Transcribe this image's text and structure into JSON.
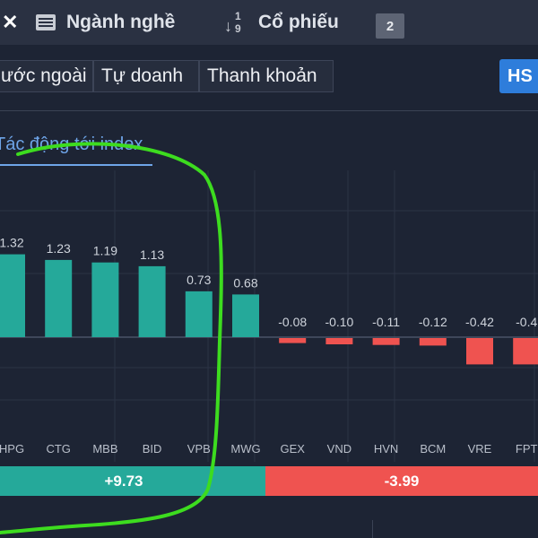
{
  "header": {
    "close_glyph": "✕",
    "industry_label": "Ngành nghề",
    "sort_digit_top": "1",
    "sort_digit_bottom": "9",
    "stocks_label": "Cổ phiếu",
    "badge_count": "2"
  },
  "filters": {
    "foreign_label": "ước ngoài",
    "proprietary_label": "Tự doanh",
    "liquidity_label": "Thanh khoản",
    "exchange_label": "HS"
  },
  "subtab": {
    "label": "Tác động tới index"
  },
  "colors": {
    "positive": "#25a99a",
    "negative": "#ef5350",
    "accent": "#6ea4e8",
    "annotation": "#3ddc1f"
  },
  "icons": [
    "close-icon",
    "list-icon",
    "sort-numeric-icon"
  ],
  "chart_data": {
    "type": "bar",
    "categories": [
      "HPG",
      "CTG",
      "MBB",
      "BID",
      "VPB",
      "MWG",
      "GEX",
      "VND",
      "HVN",
      "BCM",
      "VRE",
      "FPT"
    ],
    "values": [
      1.32,
      1.23,
      1.19,
      1.13,
      0.73,
      0.68,
      -0.08,
      -0.1,
      -0.11,
      -0.12,
      -0.42,
      -0.42
    ],
    "value_labels": [
      "1.32",
      "1.23",
      "1.19",
      "1.13",
      "0.73",
      "0.68",
      "-0.08",
      "-0.10",
      "-0.11",
      "-0.12",
      "-0.42",
      "-0.4"
    ],
    "title": "Tác động tới index",
    "ylim": [
      -1,
      1.8
    ],
    "grid": true
  },
  "totals": {
    "positive": "+9.73",
    "negative": "-3.99"
  }
}
